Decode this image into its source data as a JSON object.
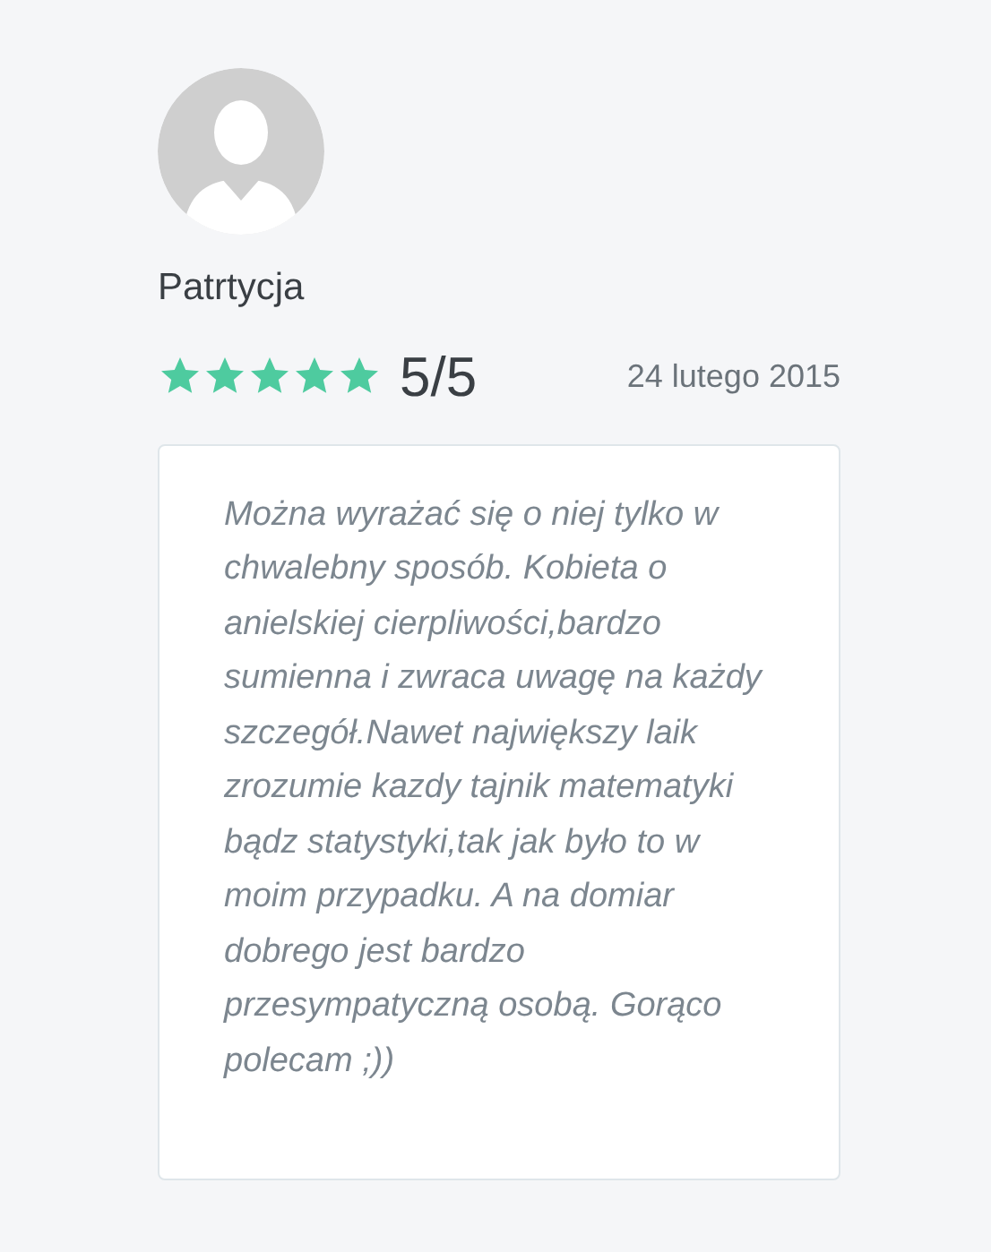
{
  "review": {
    "author": "Patrtycja",
    "stars": 5,
    "score": "5/5",
    "date": "24 lutego 2015",
    "text": "Można wyrażać się o niej tylko w chwalebny sposób. Kobieta o anielskiej cierpliwości,bardzo sumienna i zwraca uwagę na każdy szczegół.Nawet największy laik zrozumie kazdy tajnik matematyki bądz statystyki,tak jak było to w moim przypadku. A na domiar dobrego jest bardzo przesympatyczną osobą. Gorąco polecam ;))"
  }
}
